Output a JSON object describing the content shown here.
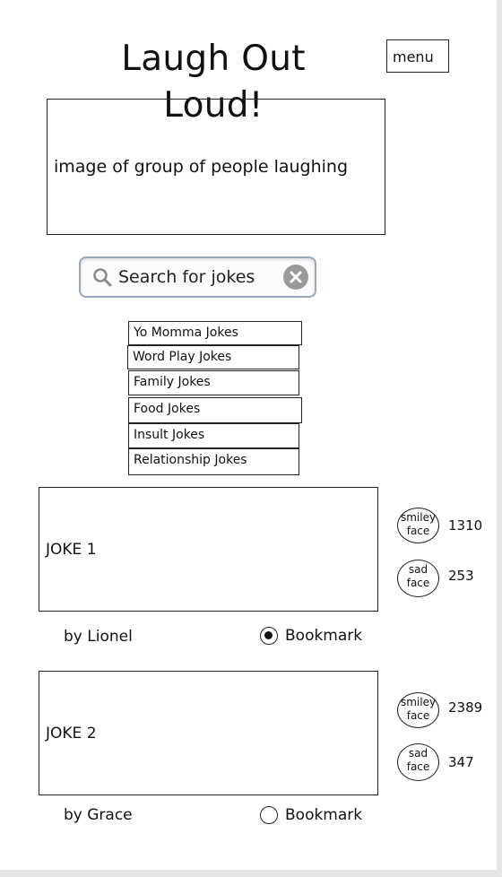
{
  "header": {
    "title": "Laugh Out Loud!",
    "menu_label": "menu"
  },
  "hero": {
    "text": "image of group of people laughing"
  },
  "search": {
    "placeholder": "Search for jokes"
  },
  "categories": [
    "Yo Momma Jokes",
    "Word Play Jokes",
    "Family Jokes",
    "Food Jokes",
    "Insult Jokes",
    "Relationship Jokes"
  ],
  "jokes": [
    {
      "title": "JOKE 1",
      "author": "by Lionel",
      "smiley_label": "smiley face",
      "smiley_count": "1310",
      "sad_label": "sad face",
      "sad_count": "253",
      "bookmark_label": "Bookmark",
      "bookmarked": true
    },
    {
      "title": "JOKE 2",
      "author": "by Grace",
      "smiley_label": "smiley face",
      "smiley_count": "2389",
      "sad_label": "sad face",
      "sad_count": "347",
      "bookmark_label": "Bookmark",
      "bookmarked": false
    }
  ]
}
